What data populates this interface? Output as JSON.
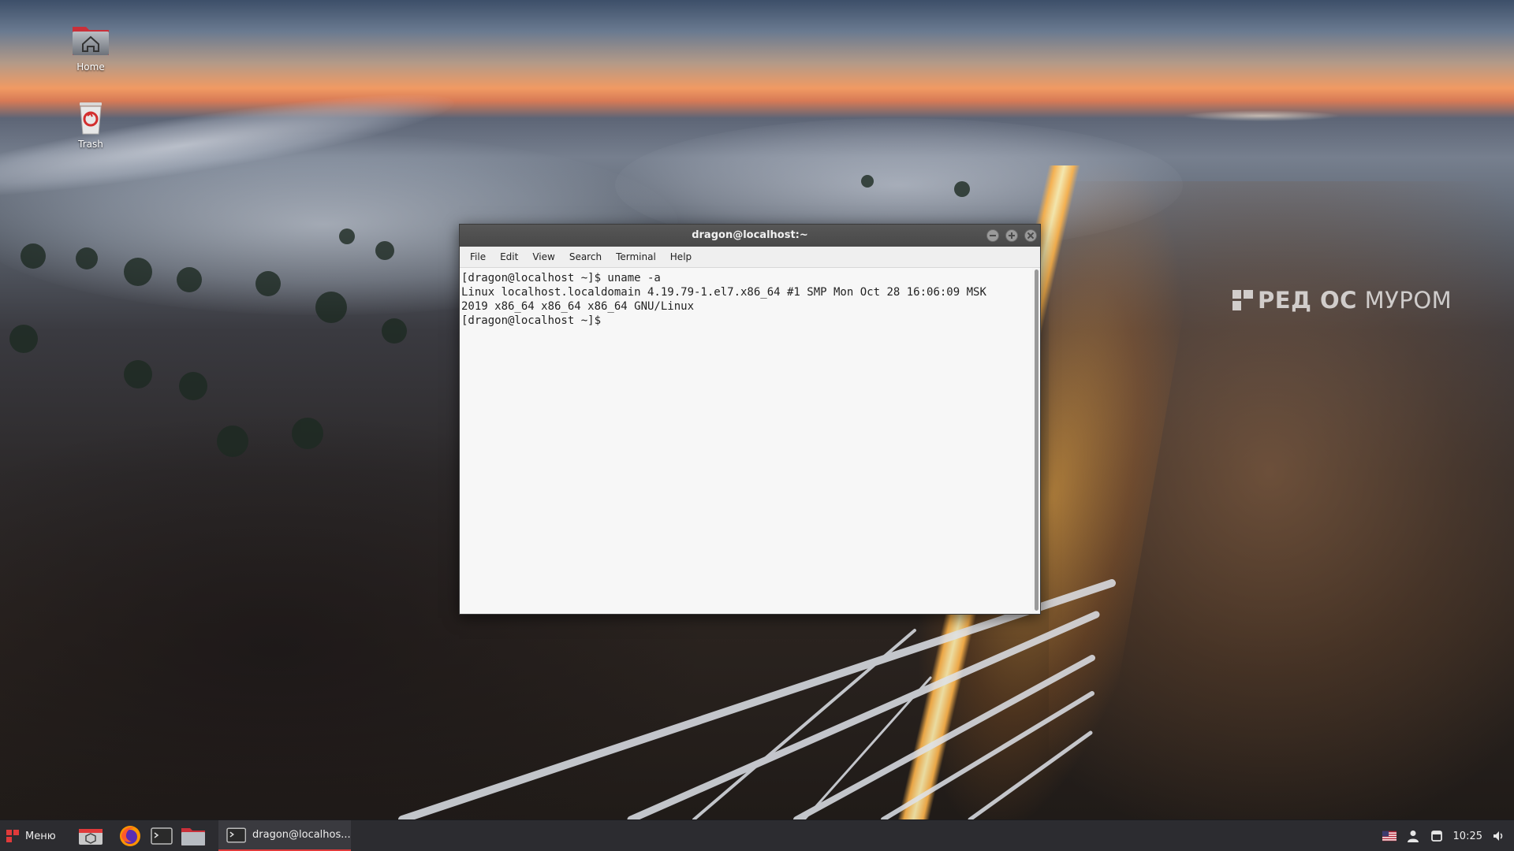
{
  "desktop": {
    "icons": [
      {
        "label": "Home",
        "icon": "home-folder-icon"
      },
      {
        "label": "Trash",
        "icon": "trash-icon"
      }
    ],
    "watermark": {
      "bold": "РЕД ОС",
      "thin": "МУРОМ"
    }
  },
  "terminal": {
    "title": "dragon@localhost:~",
    "menu": [
      "File",
      "Edit",
      "View",
      "Search",
      "Terminal",
      "Help"
    ],
    "lines": [
      "[dragon@localhost ~]$ uname -a",
      "Linux localhost.localdomain 4.19.79-1.el7.x86_64 #1 SMP Mon Oct 28 16:06:09 MSK",
      "2019 x86_64 x86_64 x86_64 GNU/Linux",
      "[dragon@localhost ~]$ "
    ]
  },
  "taskbar": {
    "menu_label": "Меню",
    "launchers": [
      "software-center-icon",
      "firefox-icon",
      "terminal-icon",
      "file-manager-icon"
    ],
    "task_label": "dragon@localhos...",
    "clock": "10:25",
    "tray_icons": [
      "us-flag-icon",
      "user-icon",
      "notification-icon",
      "volume-icon"
    ],
    "accent": "#e03a3a"
  }
}
